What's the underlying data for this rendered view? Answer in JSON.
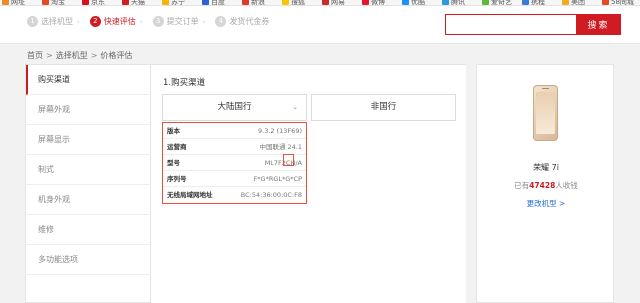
{
  "bookmarks": [
    {
      "label": "网址",
      "color": "#f08a24"
    },
    {
      "label": "淘宝",
      "color": "#e24b26"
    },
    {
      "label": "京东",
      "color": "#d7121e"
    },
    {
      "label": "天猫",
      "color": "#cf1b21"
    },
    {
      "label": "苏宁",
      "color": "#f5b400"
    },
    {
      "label": "百度",
      "color": "#2f5fd4"
    },
    {
      "label": "新浪",
      "color": "#e2392b"
    },
    {
      "label": "搜狐",
      "color": "#f7c600"
    },
    {
      "label": "网易",
      "color": "#cc2a2a"
    },
    {
      "label": "微博",
      "color": "#e6162d"
    },
    {
      "label": "优酷",
      "color": "#1e90ff"
    },
    {
      "label": "腾讯",
      "color": "#2b9be0"
    },
    {
      "label": "爱奇艺",
      "color": "#5fb83d"
    },
    {
      "label": "携程",
      "color": "#3a7dd8"
    },
    {
      "label": "美团",
      "color": "#f4a81d"
    },
    {
      "label": "58同城",
      "color": "#e24b26"
    }
  ],
  "steps": [
    {
      "num": "1",
      "label": "选择机型",
      "active": false
    },
    {
      "num": "2",
      "label": "快速评估",
      "active": true
    },
    {
      "num": "3",
      "label": "提交订单",
      "active": false
    },
    {
      "num": "4",
      "label": "发货代金券",
      "active": false
    }
  ],
  "search": {
    "placeholder": "",
    "button": "搜索"
  },
  "breadcrumb": {
    "home": "首页",
    "model": "选择机型",
    "current": "价格评估",
    "sep": ">"
  },
  "sidebar": {
    "items": [
      "购买渠道",
      "屏幕外观",
      "屏幕显示",
      "制式",
      "机身外观",
      "维修",
      "多功能选项"
    ]
  },
  "main": {
    "section_title": "1.购买渠道",
    "region_a": "大陆国行",
    "region_b": "非国行",
    "info": [
      {
        "k": "版本",
        "v": "9.3.2 (13F69)"
      },
      {
        "k": "运营商",
        "v": "中国联通 24.1"
      },
      {
        "k": "型号",
        "v": "ML7F2CH/A"
      },
      {
        "k": "序列号",
        "v": "F*G*RGL*G*CP"
      },
      {
        "k": "无线局域网地址",
        "v": "BC:54:36:00:0C:F8"
      }
    ]
  },
  "product": {
    "name": "荣耀 7i",
    "count_prefix": "已有",
    "count": "47428",
    "count_suffix": "人收钱",
    "change": "更改机型 >"
  },
  "colors": {
    "accent": "#cf1b21",
    "link": "#1f6fd6",
    "highlight": "#e8513a"
  }
}
